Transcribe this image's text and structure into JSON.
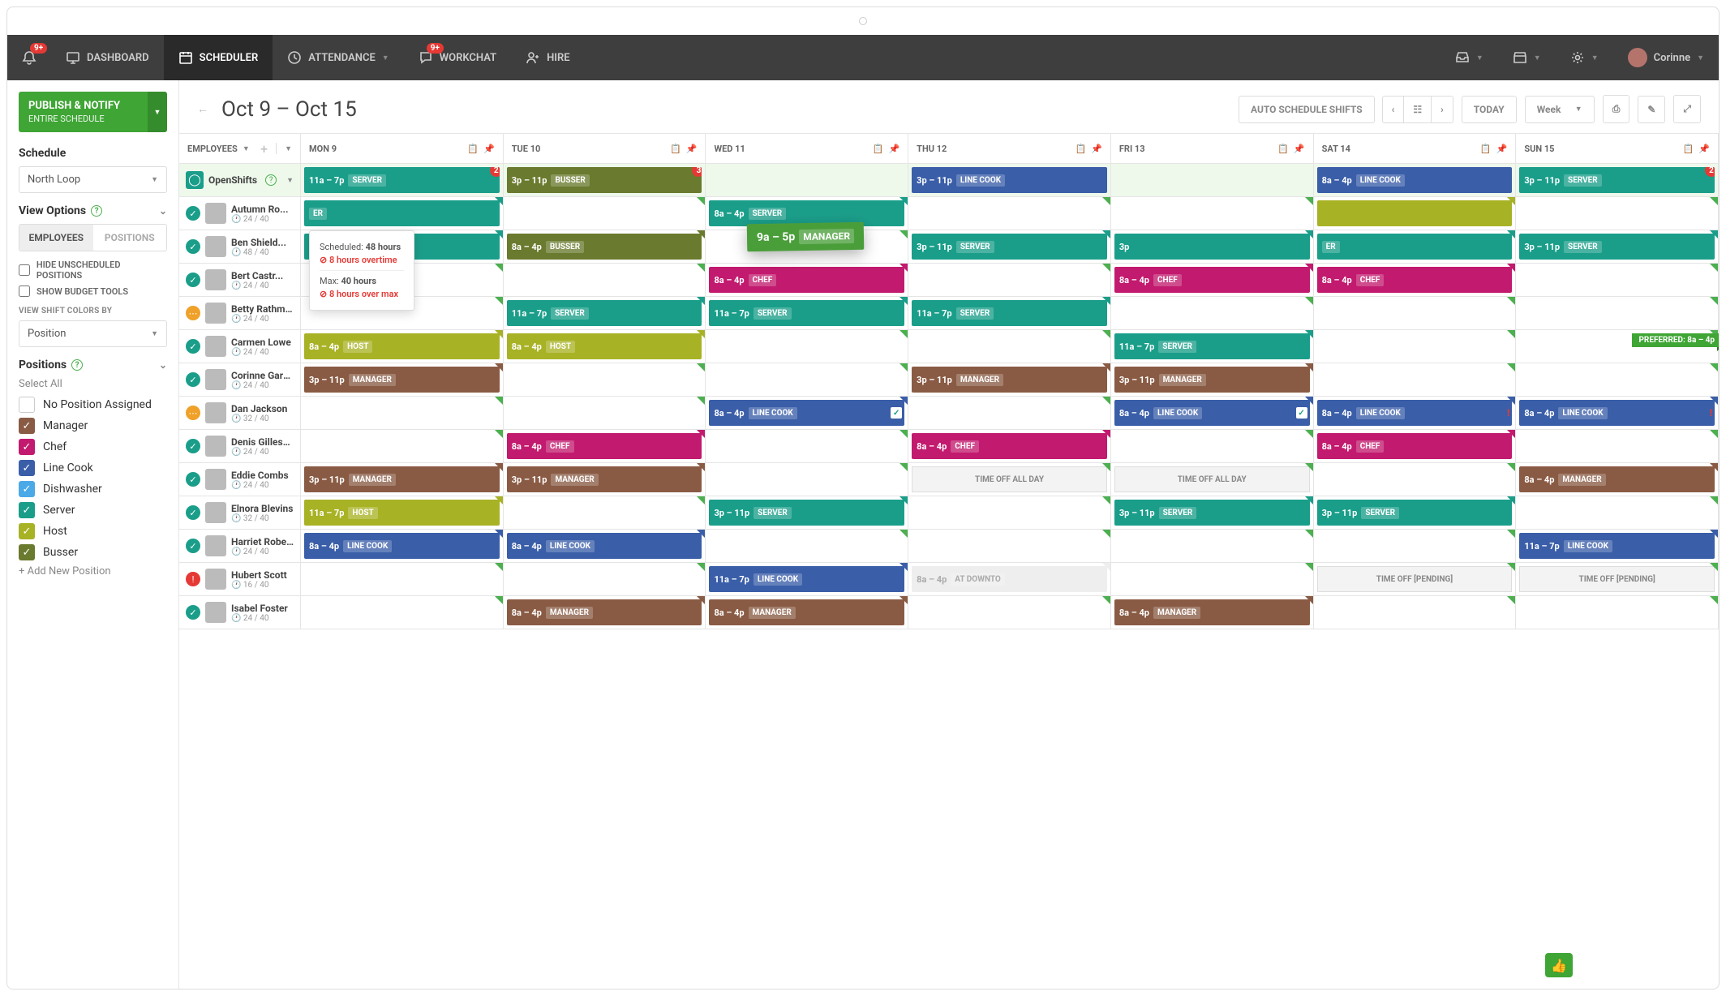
{
  "nav": {
    "notifications_badge": "9+",
    "items": [
      "DASHBOARD",
      "SCHEDULER",
      "ATTENDANCE",
      "WORKCHAT",
      "HIRE"
    ],
    "workchat_badge": "9+",
    "user_name": "Corinne"
  },
  "sidebar": {
    "publish_title": "PUBLISH & NOTIFY",
    "publish_sub": "ENTIRE SCHEDULE",
    "schedule_label": "Schedule",
    "schedule_value": "North Loop",
    "view_options_label": "View Options",
    "toggle_employees": "EMPLOYEES",
    "toggle_positions": "POSITIONS",
    "hide_unscheduled": "HIDE UNSCHEDULED POSITIONS",
    "show_budget": "SHOW BUDGET TOOLS",
    "view_colors_label": "VIEW SHIFT COLORS BY",
    "view_colors_value": "Position",
    "positions_label": "Positions",
    "select_all": "Select All",
    "positions": [
      {
        "label": "No Position Assigned",
        "color": "#fff",
        "checked": false,
        "border": "#ccc"
      },
      {
        "label": "Manager",
        "color": "#8a5b44",
        "checked": true
      },
      {
        "label": "Chef",
        "color": "#c21a6e",
        "checked": true
      },
      {
        "label": "Line Cook",
        "color": "#3a5ea8",
        "checked": true
      },
      {
        "label": "Dishwasher",
        "color": "#4ba9e8",
        "checked": true
      },
      {
        "label": "Server",
        "color": "#1a9e8a",
        "checked": true
      },
      {
        "label": "Host",
        "color": "#a8b225",
        "checked": true
      },
      {
        "label": "Busser",
        "color": "#6a7a2e",
        "checked": true
      }
    ],
    "add_position": "+ Add New Position"
  },
  "toolbar": {
    "title": "Oct 9 – Oct 15",
    "auto_schedule": "AUTO SCHEDULE SHIFTS",
    "today": "TODAY",
    "view": "Week"
  },
  "days": [
    "MON 9",
    "TUE 10",
    "WED 11",
    "THU 12",
    "FRI 13",
    "SAT 14",
    "SUN 15"
  ],
  "employees_header": "EMPLOYEES",
  "openshifts": {
    "label": "OpenShifts",
    "shifts": [
      {
        "day": 0,
        "time": "11a – 7p",
        "role": "SERVER",
        "color": "#1a9e8a",
        "badge": "2"
      },
      {
        "day": 1,
        "time": "3p – 11p",
        "role": "BUSSER",
        "color": "#6a7a2e",
        "badge": "3"
      },
      {
        "day": 3,
        "time": "3p – 11p",
        "role": "LINE COOK",
        "color": "#3a5ea8"
      },
      {
        "day": 5,
        "time": "8a – 4p",
        "role": "LINE COOK",
        "color": "#3a5ea8"
      },
      {
        "day": 6,
        "time": "3p – 11p",
        "role": "SERVER",
        "color": "#1a9e8a",
        "badge": "2"
      }
    ]
  },
  "tooltip": {
    "scheduled_label": "Scheduled:",
    "scheduled_value": "48 hours",
    "alert1": "8 hours overtime",
    "max_label": "Max:",
    "max_value": "40 hours",
    "alert2": "8 hours over max"
  },
  "drag": {
    "time": "9a – 5p",
    "role": "MANAGER"
  },
  "pref_label": "PREFERRED: 8a – 4p",
  "employees": [
    {
      "name": "Autumn Ro...",
      "hours": "24 / 40",
      "status": "ok",
      "shifts": [
        {
          "day": 0,
          "time": "",
          "role": "ER",
          "color": "#1a9e8a",
          "partial": true
        },
        {
          "day": 2,
          "time": "8a – 4p",
          "role": "SERVER",
          "color": "#1a9e8a"
        },
        {
          "day": 5,
          "color": "#a8b225",
          "placeholder": true
        }
      ]
    },
    {
      "name": "Ben Shield...",
      "hours": "48 / 40",
      "status": "ok",
      "alert": true,
      "shifts": [
        {
          "day": 0,
          "time": "",
          "role": "ER",
          "color": "#1a9e8a",
          "partial": true
        },
        {
          "day": 1,
          "time": "8a – 4p",
          "role": "BUSSER",
          "color": "#6a7a2e"
        },
        {
          "day": 3,
          "time": "3p – 11p",
          "role": "SERVER",
          "color": "#1a9e8a"
        },
        {
          "day": 4,
          "time": "3p",
          "role": "",
          "color": "#1a9e8a",
          "narrow": true
        },
        {
          "day": 5,
          "time": "",
          "role": "ER",
          "color": "#1a9e8a",
          "end": true
        },
        {
          "day": 6,
          "time": "3p – 11p",
          "role": "SERVER",
          "color": "#1a9e8a"
        }
      ]
    },
    {
      "name": "Bert Castr...",
      "hours": "24 / 40",
      "status": "ok",
      "shifts": [
        {
          "day": 2,
          "time": "8a – 4p",
          "role": "CHEF",
          "color": "#c21a6e"
        },
        {
          "day": 4,
          "time": "8a – 4p",
          "role": "CHEF",
          "color": "#c21a6e"
        },
        {
          "day": 5,
          "time": "8a – 4p",
          "role": "CHEF",
          "color": "#c21a6e"
        }
      ]
    },
    {
      "name": "Betty Rathmen",
      "hours": "24 / 40",
      "status": "warn",
      "shifts": [
        {
          "day": 1,
          "time": "11a – 7p",
          "role": "SERVER",
          "color": "#1a9e8a"
        },
        {
          "day": 2,
          "time": "11a – 7p",
          "role": "SERVER",
          "color": "#1a9e8a"
        },
        {
          "day": 3,
          "time": "11a – 7p",
          "role": "SERVER",
          "color": "#1a9e8a"
        }
      ]
    },
    {
      "name": "Carmen Lowe",
      "hours": "24 / 40",
      "status": "ok",
      "shifts": [
        {
          "day": 0,
          "time": "8a – 4p",
          "role": "HOST",
          "color": "#a8b225"
        },
        {
          "day": 1,
          "time": "8a – 4p",
          "role": "HOST",
          "color": "#a8b225"
        },
        {
          "day": 4,
          "time": "11a – 7p",
          "role": "SERVER",
          "color": "#1a9e8a"
        }
      ],
      "pref_day": 6
    },
    {
      "name": "Corinne Garris...",
      "hours": "24 / 40",
      "status": "ok",
      "shifts": [
        {
          "day": 0,
          "time": "3p – 11p",
          "role": "MANAGER",
          "color": "#8a5b44"
        },
        {
          "day": 3,
          "time": "3p – 11p",
          "role": "MANAGER",
          "color": "#8a5b44"
        },
        {
          "day": 4,
          "time": "3p – 11p",
          "role": "MANAGER",
          "color": "#8a5b44"
        }
      ]
    },
    {
      "name": "Dan Jackson",
      "hours": "32 / 40",
      "status": "warn",
      "shifts": [
        {
          "day": 2,
          "time": "8a – 4p",
          "role": "LINE COOK",
          "color": "#3a5ea8",
          "check": true
        },
        {
          "day": 4,
          "time": "8a – 4p",
          "role": "LINE COOK",
          "color": "#3a5ea8",
          "check": true
        },
        {
          "day": 5,
          "time": "8a – 4p",
          "role": "LINE COOK",
          "color": "#3a5ea8",
          "alert": true
        },
        {
          "day": 6,
          "time": "8a – 4p",
          "role": "LINE COOK",
          "color": "#3a5ea8",
          "alert": true
        }
      ]
    },
    {
      "name": "Denis Gillespie",
      "hours": "24 / 40",
      "status": "ok",
      "shifts": [
        {
          "day": 1,
          "time": "8a – 4p",
          "role": "CHEF",
          "color": "#c21a6e"
        },
        {
          "day": 3,
          "time": "8a – 4p",
          "role": "CHEF",
          "color": "#c21a6e",
          "striped": true
        },
        {
          "day": 5,
          "time": "8a – 4p",
          "role": "CHEF",
          "color": "#c21a6e",
          "striped": true
        }
      ]
    },
    {
      "name": "Eddie Combs",
      "hours": "24 / 40",
      "status": "ok",
      "shifts": [
        {
          "day": 0,
          "time": "3p – 11p",
          "role": "MANAGER",
          "color": "#8a5b44"
        },
        {
          "day": 1,
          "time": "3p – 11p",
          "role": "MANAGER",
          "color": "#8a5b44"
        },
        {
          "day": 3,
          "timeoff": "TIME OFF ALL DAY"
        },
        {
          "day": 4,
          "timeoff": "TIME OFF ALL DAY"
        },
        {
          "day": 6,
          "time": "8a – 4p",
          "role": "MANAGER",
          "color": "#8a5b44"
        }
      ]
    },
    {
      "name": "Elnora Blevins",
      "hours": "32 / 40",
      "status": "ok",
      "shifts": [
        {
          "day": 0,
          "time": "11a – 7p",
          "role": "HOST",
          "color": "#a8b225"
        },
        {
          "day": 2,
          "time": "3p – 11p",
          "role": "SERVER",
          "color": "#1a9e8a"
        },
        {
          "day": 4,
          "time": "3p – 11p",
          "role": "SERVER",
          "color": "#1a9e8a"
        },
        {
          "day": 5,
          "time": "3p – 11p",
          "role": "SERVER",
          "color": "#1a9e8a"
        }
      ]
    },
    {
      "name": "Harriet Roberts",
      "hours": "24 / 40",
      "status": "ok",
      "shifts": [
        {
          "day": 0,
          "time": "8a – 4p",
          "role": "LINE COOK",
          "color": "#3a5ea8",
          "striped": true
        },
        {
          "day": 1,
          "time": "8a – 4p",
          "role": "LINE COOK",
          "color": "#3a5ea8",
          "striped": true
        },
        {
          "day": 6,
          "time": "11a – 7p",
          "role": "LINE COOK",
          "color": "#3a5ea8"
        }
      ]
    },
    {
      "name": "Hubert Scott",
      "hours": "16 / 40",
      "status": "alert",
      "shifts": [
        {
          "day": 2,
          "time": "11a – 7p",
          "role": "LINE COOK",
          "color": "#3a5ea8"
        },
        {
          "day": 3,
          "time": "8a – 4p",
          "role": "AT DOWNTO",
          "color": "#eee",
          "faded": true
        },
        {
          "day": 5,
          "timeoff": "TIME OFF [PENDING]"
        },
        {
          "day": 6,
          "timeoff": "TIME OFF [PENDING]"
        }
      ]
    },
    {
      "name": "Isabel Foster",
      "hours": "24 / 40",
      "status": "ok",
      "shifts": [
        {
          "day": 1,
          "time": "8a – 4p",
          "role": "MANAGER",
          "color": "#8a5b44"
        },
        {
          "day": 2,
          "time": "8a – 4p",
          "role": "MANAGER",
          "color": "#8a5b44"
        },
        {
          "day": 4,
          "time": "8a – 4p",
          "role": "MANAGER",
          "color": "#8a5b44"
        }
      ]
    }
  ]
}
